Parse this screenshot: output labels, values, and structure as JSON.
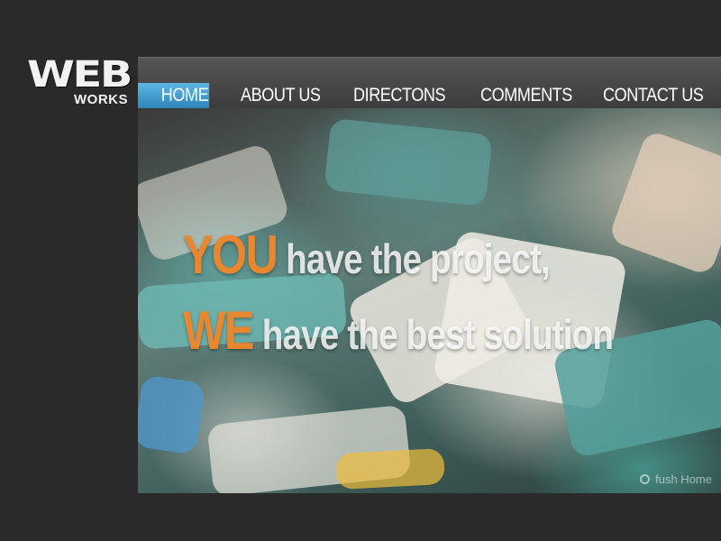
{
  "logo": {
    "line1": "WEB",
    "line2": "WORKS"
  },
  "nav": {
    "active_color": "#3a9bd0",
    "items": [
      {
        "label": "HOME",
        "active": true
      },
      {
        "label": "ABOUT US",
        "active": false
      },
      {
        "label": "DIRECTONS",
        "active": false
      },
      {
        "label": "COMMENTS",
        "active": false
      },
      {
        "label": "CONTACT US",
        "active": false
      }
    ]
  },
  "hero": {
    "line1": {
      "accent": "YOU",
      "rest": "have the project,"
    },
    "line2": {
      "accent": "WE",
      "rest": "have the best solution"
    },
    "accent_color": "#e8872f",
    "image": "jigsaw-puzzle-pieces-photo"
  },
  "watermark": {
    "text": "fush Home"
  }
}
